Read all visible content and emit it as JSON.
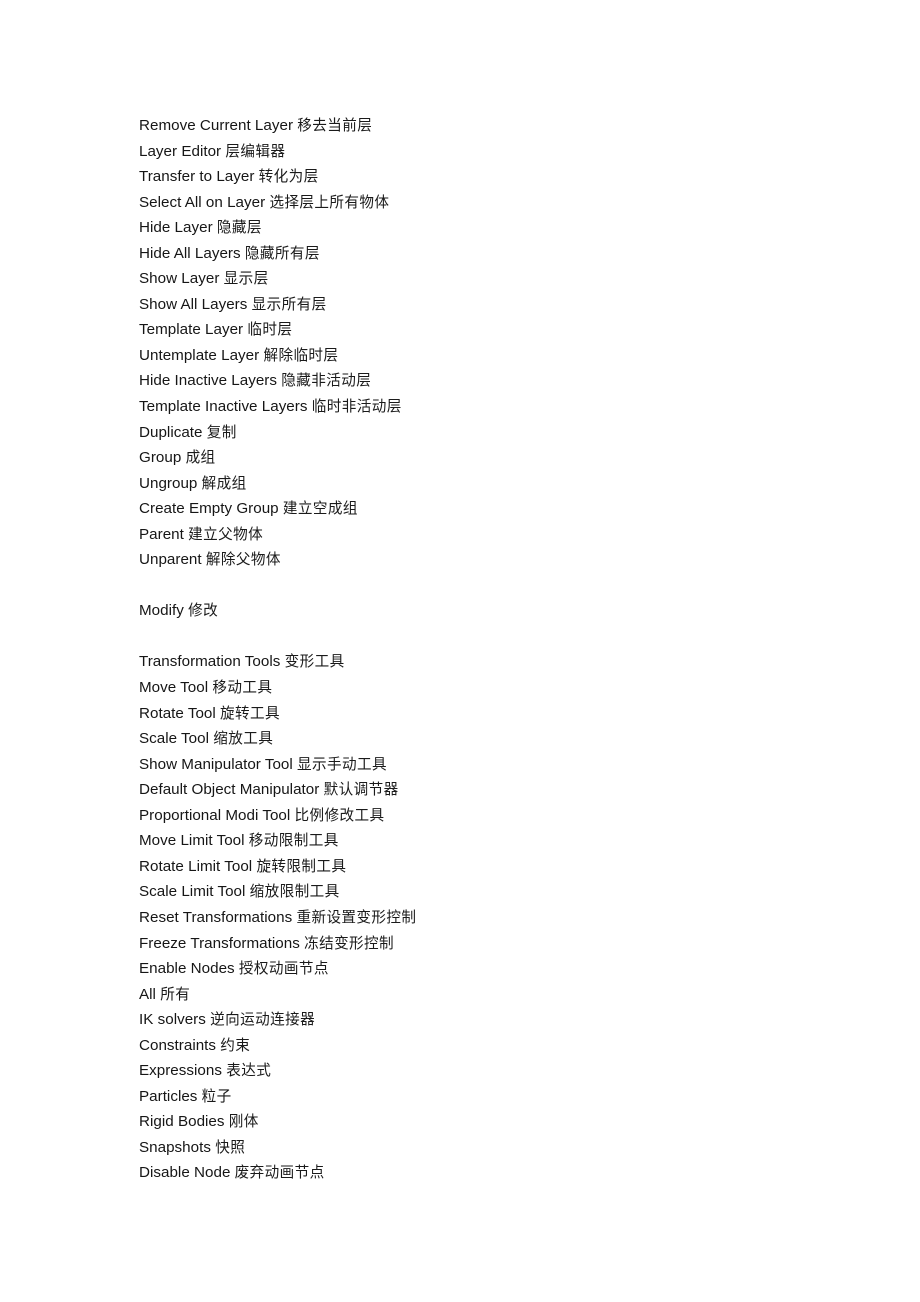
{
  "document": {
    "page_background": "#ffffff",
    "text_color": "#161616",
    "lines": [
      {
        "en": "Remove Current Layer",
        "zh": "移去当前层"
      },
      {
        "en": "Layer Editor",
        "zh": "层编辑器"
      },
      {
        "en": "Transfer to Layer",
        "zh": "转化为层"
      },
      {
        "en": "Select All on Layer",
        "zh": "选择层上所有物体"
      },
      {
        "en": "Hide Layer",
        "zh": "隐藏层"
      },
      {
        "en": "Hide All Layers",
        "zh": "隐藏所有层"
      },
      {
        "en": "Show Layer",
        "zh": "显示层"
      },
      {
        "en": "Show All Layers",
        "zh": "显示所有层"
      },
      {
        "en": "Template Layer",
        "zh": "临时层"
      },
      {
        "en": "Untemplate Layer",
        "zh": "解除临时层"
      },
      {
        "en": "Hide Inactive Layers",
        "zh": "隐藏非活动层"
      },
      {
        "en": "Template Inactive Layers",
        "zh": "临时非活动层"
      },
      {
        "en": "Duplicate",
        "zh": "复制"
      },
      {
        "en": "Group",
        "zh": "成组"
      },
      {
        "en": "Ungroup",
        "zh": "解成组"
      },
      {
        "en": "Create Empty Group",
        "zh": "建立空成组"
      },
      {
        "en": "Parent",
        "zh": "建立父物体"
      },
      {
        "en": "Unparent",
        "zh": "解除父物体"
      },
      {
        "en": "",
        "zh": ""
      },
      {
        "en": "Modify",
        "zh": "修改"
      },
      {
        "en": "",
        "zh": ""
      },
      {
        "en": "Transformation Tools",
        "zh": "变形工具"
      },
      {
        "en": "Move Tool",
        "zh": "移动工具"
      },
      {
        "en": "Rotate Tool",
        "zh": "旋转工具"
      },
      {
        "en": "Scale Tool",
        "zh": "缩放工具"
      },
      {
        "en": "Show Manipulator Tool",
        "zh": "显示手动工具"
      },
      {
        "en": "Default Object Manipulator",
        "zh": "默认调节器"
      },
      {
        "en": "Proportional Modi Tool",
        "zh": "比例修改工具"
      },
      {
        "en": "Move Limit Tool",
        "zh": "移动限制工具"
      },
      {
        "en": "Rotate Limit Tool",
        "zh": "旋转限制工具"
      },
      {
        "en": "Scale Limit Tool",
        "zh": "缩放限制工具"
      },
      {
        "en": "Reset Transformations",
        "zh": "重新设置变形控制"
      },
      {
        "en": "Freeze Transformations",
        "zh": "冻结变形控制"
      },
      {
        "en": "Enable Nodes",
        "zh": "授权动画节点"
      },
      {
        "en": "All",
        "zh": "所有"
      },
      {
        "en": "IK solvers",
        "zh": "逆向运动连接器"
      },
      {
        "en": "Constraints",
        "zh": "约束"
      },
      {
        "en": "Expressions",
        "zh": "表达式"
      },
      {
        "en": "Particles",
        "zh": "粒子"
      },
      {
        "en": "Rigid Bodies",
        "zh": "刚体"
      },
      {
        "en": "Snapshots",
        "zh": "快照"
      },
      {
        "en": "Disable Node",
        "zh": "废弃动画节点"
      }
    ]
  }
}
